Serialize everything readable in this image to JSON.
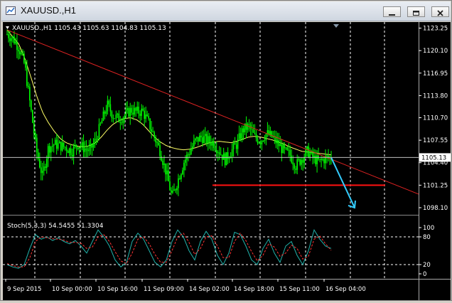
{
  "window": {
    "title": "XAUUSD.,H1"
  },
  "chart_header": {
    "symbol_info": "XAUUSD.,H1  1105.43 1105.63 1104.83 1105.13"
  },
  "price_axis": {
    "ticks": [
      "1123.25",
      "1120.10",
      "1116.95",
      "1113.80",
      "1110.70",
      "1107.55",
      "1104.40",
      "1101.25",
      "1098.10"
    ],
    "tick_values": [
      1123.25,
      1120.1,
      1116.95,
      1113.8,
      1110.7,
      1107.55,
      1104.4,
      1101.25,
      1098.1
    ],
    "current_price_label": "1105.13",
    "current_price": 1105.13
  },
  "time_axis": {
    "labels": [
      "9 Sep 2015",
      "10 Sep 00:00",
      "10 Sep 16:00",
      "11 Sep 09:00",
      "14 Sep 02:00",
      "14 Sep 18:00",
      "15 Sep 11:00",
      "16 Sep 04:00"
    ]
  },
  "oscillator": {
    "label": "Stoch(5,3,3) 54.5455 51.3304",
    "levels": [
      "100",
      "80",
      "20",
      "0"
    ],
    "level_values": [
      100,
      80,
      20,
      0
    ]
  },
  "colors": {
    "background": "#000000",
    "candles": "#00ff00",
    "moving_average": "#ffff66",
    "trendline": "#dd2222",
    "support_line": "#ff1111",
    "arrow": "#33ccff",
    "stoch_main": "#20b2aa",
    "stoch_signal": "#ff3333",
    "grid": "#ffffff",
    "text": "#ffffff"
  },
  "chart_data": [
    {
      "type": "candlestick",
      "symbol": "XAUUSD.",
      "timeframe": "H1",
      "ylim": [
        1097.5,
        1124.0
      ],
      "price_path": [
        1122.4,
        1121.8,
        1120.5,
        1118.0,
        1112.0,
        1106.0,
        1102.5,
        1106.5,
        1107.0,
        1106.8,
        1106.5,
        1106.0,
        1107.0,
        1106.5,
        1106.0,
        1107.5,
        1110.0,
        1112.5,
        1111.0,
        1110.5,
        1111.0,
        1111.8,
        1111.5,
        1111.6,
        1110.0,
        1108.0,
        1106.0,
        1103.0,
        1099.5,
        1102.0,
        1104.5,
        1106.0,
        1107.5,
        1108.0,
        1107.5,
        1107.2,
        1106.0,
        1104.8,
        1106.0,
        1107.0,
        1109.0,
        1109.5,
        1108.0,
        1107.5,
        1108.5,
        1108.0,
        1107.0,
        1106.0,
        1105.5,
        1104.0,
        1105.0,
        1106.0,
        1105.0,
        1104.5,
        1105.0,
        1105.13
      ],
      "ma_path": [
        1123.0,
        1122.0,
        1121.0,
        1119.0,
        1116.5,
        1113.8,
        1111.5,
        1110.0,
        1108.8,
        1107.8,
        1107.2,
        1106.9,
        1106.7,
        1106.6,
        1106.8,
        1107.2,
        1108.0,
        1109.0,
        1109.8,
        1110.3,
        1110.6,
        1110.7,
        1110.4,
        1109.8,
        1108.9,
        1108.0,
        1107.3,
        1106.8,
        1106.5,
        1106.3,
        1106.2,
        1106.3,
        1106.5,
        1106.8,
        1107.1,
        1107.3,
        1107.4,
        1107.3,
        1107.2,
        1107.4,
        1107.7,
        1108.0,
        1108.1,
        1108.0,
        1107.8,
        1107.6,
        1107.3,
        1107.0,
        1106.6,
        1106.3,
        1106.0,
        1105.9,
        1105.8,
        1105.7,
        1105.6,
        1105.5
      ],
      "trendline": {
        "from_price": 1123.0,
        "to_price": 1100.0
      },
      "support_level": 1101.25,
      "projection_target": 1098.1
    },
    {
      "type": "line",
      "name": "Stoch(5,3,3)",
      "ylim": [
        0,
        100
      ],
      "series": [
        {
          "name": "Stoch main",
          "values": [
            20,
            15,
            12,
            20,
            55,
            85,
            75,
            80,
            72,
            78,
            70,
            65,
            72,
            60,
            45,
            70,
            95,
            80,
            60,
            30,
            15,
            25,
            70,
            88,
            75,
            50,
            25,
            15,
            30,
            70,
            95,
            80,
            50,
            30,
            70,
            92,
            75,
            40,
            20,
            45,
            90,
            85,
            60,
            30,
            20,
            55,
            75,
            45,
            25,
            60,
            70,
            40,
            20,
            50,
            95,
            75,
            60,
            55
          ]
        },
        {
          "name": "Stoch signal",
          "values": [
            22,
            18,
            15,
            15,
            35,
            70,
            80,
            78,
            76,
            75,
            73,
            68,
            68,
            66,
            55,
            58,
            80,
            85,
            70,
            48,
            28,
            22,
            45,
            75,
            80,
            65,
            42,
            25,
            25,
            50,
            80,
            88,
            68,
            42,
            55,
            80,
            82,
            60,
            35,
            35,
            70,
            88,
            72,
            48,
            28,
            40,
            65,
            58,
            38,
            45,
            62,
            55,
            32,
            38,
            75,
            82,
            65,
            51
          ]
        }
      ],
      "hlines": [
        20,
        80
      ]
    }
  ]
}
